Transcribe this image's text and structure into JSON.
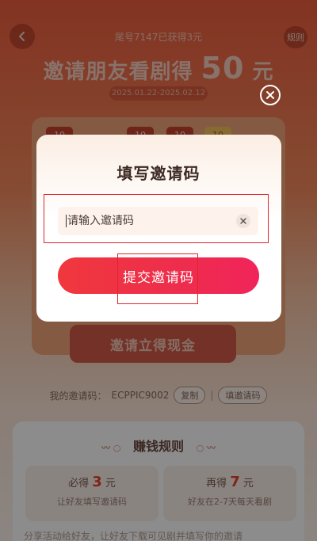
{
  "header": {
    "tail_text": "尾号7147已获得3元",
    "rules_label": "规则",
    "title_prefix": "邀请朋友看剧得",
    "title_amount": "50",
    "title_unit": "元",
    "date_range": "2025.01.22-2025.02.12"
  },
  "background": {
    "chip_1": "10",
    "chip_2": "10",
    "chip_3": "10",
    "chip_4": "10",
    "invite_cash_label": "邀请立得现金",
    "my_code_label": "我的邀请码：",
    "my_code_value": "ECPPIC9002",
    "copy_label": "复制",
    "separator": "|",
    "fill_code_label": "填邀请码"
  },
  "rules": {
    "heading": "赚钱规则",
    "box1_prefix": "必得",
    "box1_amount": "3",
    "box1_unit": "元",
    "box1_desc": "让好友填写邀请码",
    "box2_prefix": "再得",
    "box2_amount": "7",
    "box2_unit": "元",
    "box2_desc": "好友在2-7天每天看剧",
    "bottom_text": "分享活动给好友，让好友下载可见剧并填写你的邀请"
  },
  "dialog": {
    "title": "填写邀请码",
    "input_placeholder": "请输入邀请码",
    "input_value": "",
    "submit_label": "提交邀请码"
  },
  "colors": {
    "accent": "#f0373d",
    "highlight_frame": "#e0252a",
    "title_text": "#3d2b24"
  },
  "icons": {
    "back": "back-arrow-icon",
    "close": "close-icon",
    "clear": "clear-icon",
    "deco": "wave-deco-icon"
  }
}
